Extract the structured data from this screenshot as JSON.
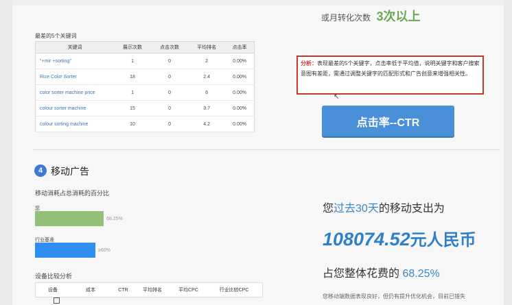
{
  "conversion": {
    "label": "或月转化次数",
    "value": "3次以上"
  },
  "keywords": {
    "title": "最差的5个关键词",
    "headers": [
      "关键词",
      "展示次数",
      "点击次数",
      "平均排名",
      "点击率"
    ],
    "rows": [
      [
        "\"+mir +sorting\"",
        "1",
        "0",
        "2",
        "0.00%"
      ],
      [
        "Rice Color Sorter",
        "18",
        "0",
        "2.4",
        "0.00%"
      ],
      [
        "color sorter machine price",
        "1",
        "0",
        "6",
        "0.00%"
      ],
      [
        "colour sorter machine",
        "15",
        "0",
        "3.7",
        "0.00%"
      ],
      [
        "colour sorting machine",
        "10",
        "0",
        "4.2",
        "0.00%"
      ]
    ]
  },
  "analysis": {
    "label": "分析：",
    "text": "表现最差的5个关键字，点击率低于平均值，说明关键字和客户搜索意图有差距，需通过调整关键字的匹配形式和广告创意来增强相关性。"
  },
  "ctr_button": "点击率--CTR",
  "mobile": {
    "number": "4",
    "title": "移动广告",
    "subtitle": "移动消耗占总消耗的百分比",
    "bars": [
      {
        "label": "您",
        "percent_text": "68.25%",
        "fraction": 0.6825,
        "color": "#93bf77"
      },
      {
        "label": "行业基准",
        "percent_text": "≥60%",
        "fraction": 0.6,
        "color": "#2e8ff0"
      }
    ],
    "device_title": "设备比较分析",
    "device_headers": [
      "设备",
      "成本",
      "CTR",
      "平均排名",
      "平均CPC",
      "行业比较CPC"
    ]
  },
  "stats": {
    "spend_pre": "您",
    "spend_highlight": "过去30天",
    "spend_post": "的移动支出为",
    "amount": "108074.52",
    "currency": "元人民币",
    "share_pre": "占您整体花费的",
    "share_pct": "68.25%",
    "footer": "您移动端数据表现良好，但仍有提升优化机会，目前已错失"
  }
}
